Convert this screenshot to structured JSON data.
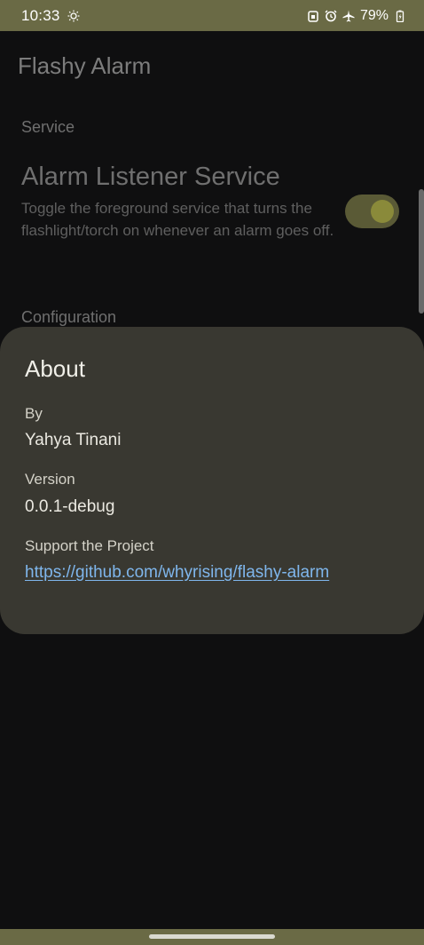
{
  "status_bar": {
    "time": "10:33",
    "battery": "79%",
    "icons": [
      "brightness-icon",
      "lock-icon",
      "alarm-icon",
      "airplane-icon",
      "battery-icon"
    ]
  },
  "app": {
    "title": "Flashy Alarm",
    "sections": {
      "service": "Service",
      "configuration": "Configuration"
    },
    "preference": {
      "title": "Alarm Listener Service",
      "summary": "Toggle the foreground service that turns the flashlight/torch on whenever an alarm goes off.",
      "enabled": true
    }
  },
  "dialog": {
    "title": "About",
    "by_label": "By",
    "by_value": "Yahya Tinani",
    "version_label": "Version",
    "version_value": "0.0.1-debug",
    "support_label": "Support the Project",
    "support_link": "https://github.com/whyrising/flashy-alarm"
  },
  "colors": {
    "status_bar": "#6a6a45",
    "dialog_surface": "#393831",
    "link": "#7fb6ec",
    "background": "#0f0f10"
  }
}
